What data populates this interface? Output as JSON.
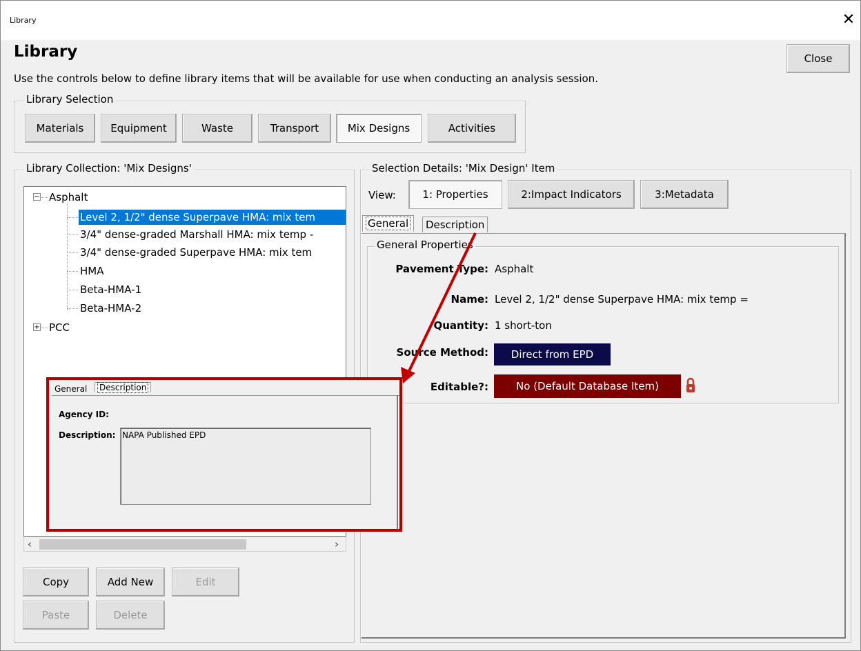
{
  "window": {
    "title": "Library",
    "heading": "Library",
    "intro": "Use the controls below to define library items that will be available for use when conducting an analysis session.",
    "close_label": "Close"
  },
  "library_selection": {
    "title": "Library Selection",
    "buttons": [
      "Materials",
      "Equipment",
      "Waste",
      "Transport",
      "Mix Designs",
      "Activities"
    ],
    "active": "Mix Designs"
  },
  "collection": {
    "title": "Library Collection: 'Mix Designs'",
    "root1": "Asphalt",
    "items": [
      "Level 2, 1/2\" dense Superpave HMA: mix tem",
      "3/4\" dense-graded Marshall HMA: mix temp -",
      "3/4\" dense-graded Superpave HMA: mix tem",
      "HMA",
      "Beta-HMA-1",
      "Beta-HMA-2"
    ],
    "root2": "PCC",
    "buttons": {
      "copy": "Copy",
      "add_new": "Add New",
      "edit": "Edit",
      "paste": "Paste",
      "delete": "Delete"
    }
  },
  "details": {
    "title": "Selection Details: 'Mix Design' Item",
    "view_label": "View:",
    "view_buttons": [
      "1: Properties",
      "2:Impact Indicators",
      "3:Metadata"
    ],
    "tabs": [
      "General",
      "Description"
    ],
    "group_title": "General Properties",
    "props": {
      "pavement_type_label": "Pavement Type:",
      "pavement_type": "Asphalt",
      "name_label": "Name:",
      "name": "Level 2, 1/2\" dense Superpave HMA: mix temp =",
      "quantity_label": "Quantity:",
      "quantity": "1 short-ton",
      "source_method_label": "Source Method:",
      "source_method": "Direct from EPD",
      "editable_label": "Editable?:",
      "editable": "No (Default Database Item)"
    },
    "colors": {
      "source_badge": "#0b0b4a",
      "editable_badge": "#7d0000",
      "lock": "#c0392b"
    }
  },
  "inset": {
    "tabs": [
      "General",
      "Description"
    ],
    "agency_label": "Agency ID:",
    "description_label": "Description:",
    "description_value": "NAPA Published EPD",
    "colors": {
      "frame": "#b00000",
      "arrow": "#c00000"
    }
  }
}
